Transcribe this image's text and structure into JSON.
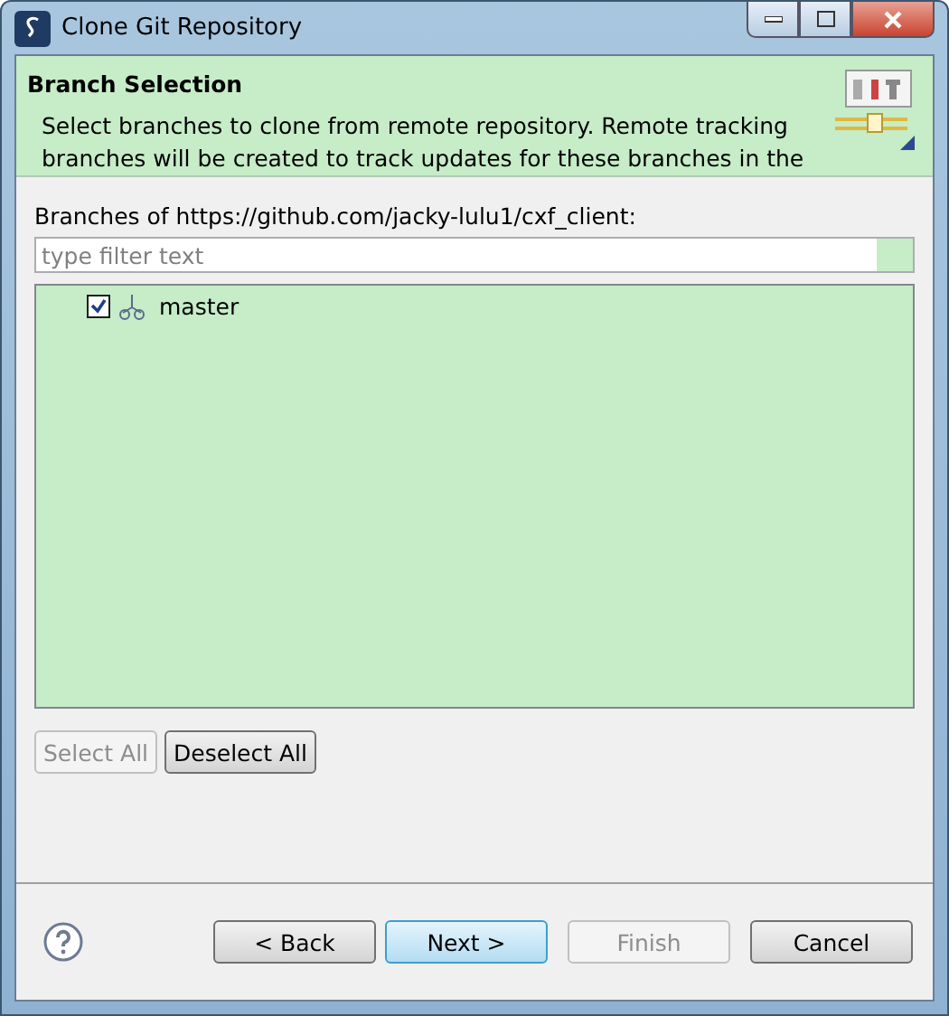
{
  "window": {
    "title": "Clone Git Repository"
  },
  "header": {
    "title": "Branch Selection",
    "description": "Select branches to clone from remote repository. Remote tracking branches will be created to track updates for these branches in the"
  },
  "branches_label": "Branches of https://github.com/jacky-lulu1/cxf_client:",
  "filter": {
    "placeholder": "type filter text"
  },
  "branches": [
    {
      "name": "master",
      "checked": true
    }
  ],
  "selection_buttons": [
    {
      "label": "Select All",
      "disabled": true
    },
    {
      "label": "Deselect All",
      "disabled": false
    }
  ],
  "nav_buttons": [
    {
      "label": "< Back",
      "disabled": false,
      "default": false
    },
    {
      "label": "Next >",
      "disabled": false,
      "default": true
    },
    {
      "label": "Finish",
      "disabled": true,
      "default": false
    },
    {
      "label": "Cancel",
      "disabled": false,
      "default": false
    }
  ]
}
